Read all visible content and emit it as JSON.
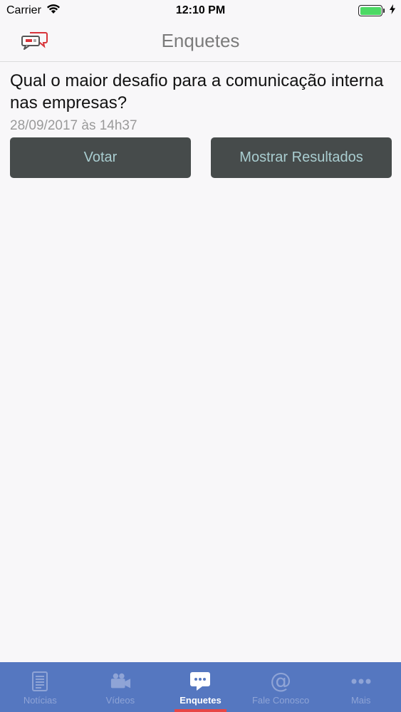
{
  "status_bar": {
    "carrier": "Carrier",
    "time": "12:10 PM"
  },
  "nav": {
    "title": "Enquetes",
    "logo_icon": "chat-bubbles-icon"
  },
  "poll": {
    "question": "Qual o maior desafio para a comunicação interna nas empresas?",
    "date": "28/09/2017 às 14h37",
    "vote_label": "Votar",
    "results_label": "Mostrar Resultados"
  },
  "tabs": [
    {
      "label": "Notícias",
      "icon": "newspaper-icon",
      "active": false
    },
    {
      "label": "Vídeos",
      "icon": "video-camera-icon",
      "active": false
    },
    {
      "label": "Enquetes",
      "icon": "chat-bubble-icon",
      "active": true
    },
    {
      "label": "Fale Conosco",
      "icon": "at-sign-icon",
      "active": false
    },
    {
      "label": "Mais",
      "icon": "more-dots-icon",
      "active": false
    }
  ],
  "colors": {
    "tab_bar": "#5577c0",
    "active_indicator": "#e74646",
    "button_bg": "#464b4b",
    "button_text": "#a9cdd0",
    "battery": "#4cd964"
  }
}
